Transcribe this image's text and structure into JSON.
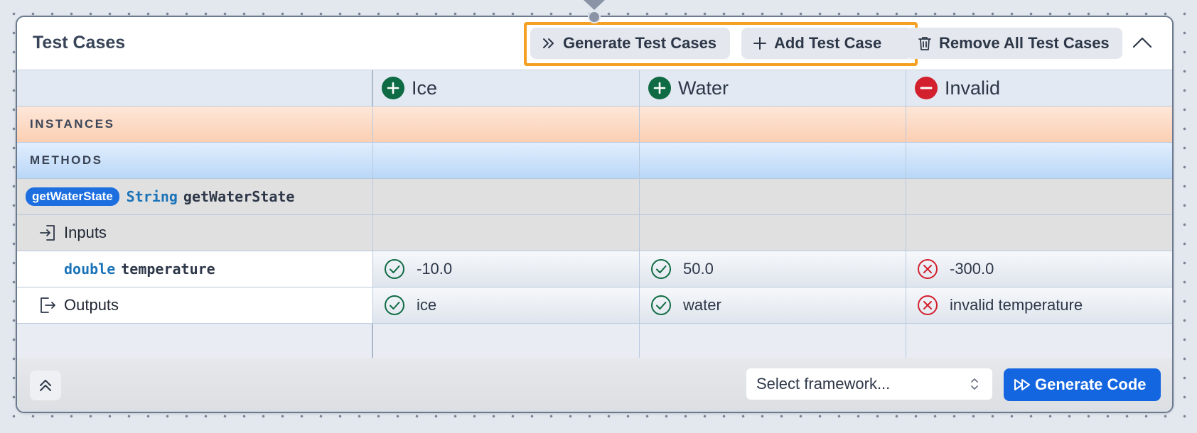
{
  "header": {
    "title": "Test Cases",
    "generate_label": "Generate Test Cases",
    "add_label": "Add Test Case",
    "remove_label": "Remove All Test Cases"
  },
  "columns": [
    {
      "name": "Ice",
      "kind": "valid"
    },
    {
      "name": "Water",
      "kind": "valid"
    },
    {
      "name": "Invalid",
      "kind": "invalid"
    }
  ],
  "sections": {
    "instances": "INSTANCES",
    "methods": "METHODS"
  },
  "method": {
    "pill": "getWaterState",
    "return_type": "String",
    "name": "getWaterState"
  },
  "inputs_label": "Inputs",
  "parameter": {
    "type": "double",
    "name": "temperature",
    "values": [
      "-10.0",
      "50.0",
      "-300.0"
    ],
    "status": [
      "pass",
      "pass",
      "fail"
    ]
  },
  "outputs": {
    "label": "Outputs",
    "values": [
      "ice",
      "water",
      "invalid temperature"
    ],
    "status": [
      "pass",
      "pass",
      "fail"
    ]
  },
  "footer": {
    "framework_placeholder": "Select framework...",
    "generate_code_label": "Generate Code"
  },
  "colors": {
    "accent_blue": "#1466e0",
    "highlight_orange": "#f5a024",
    "pass_green": "#0e6b43",
    "fail_red": "#d3202f"
  }
}
